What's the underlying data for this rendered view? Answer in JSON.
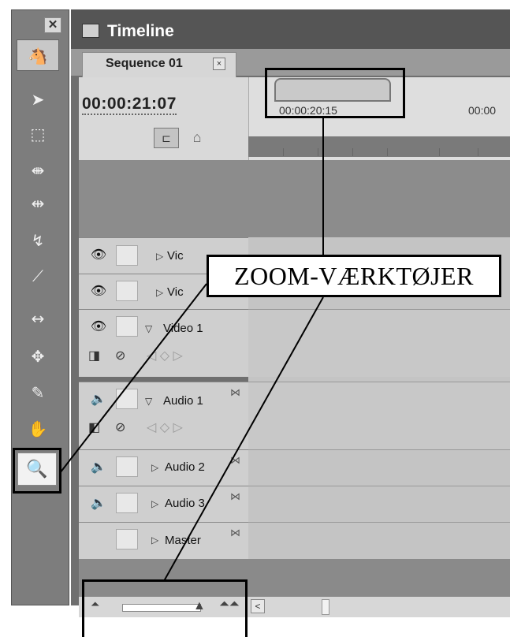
{
  "tools": {
    "close_label": "✕",
    "items": [
      "track-select-icon",
      "selection-arrow-icon",
      "ripple-edit-icon",
      "rolling-edit-icon",
      "rate-stretch-icon",
      "razor-icon",
      "slip-icon",
      "slide-icon",
      "pen-icon",
      "hand-icon",
      "zoom-icon"
    ]
  },
  "window": {
    "title": "Timeline"
  },
  "sequence": {
    "tab_label": "Sequence 01",
    "tab_close": "×",
    "timecode": "00:00:21:07",
    "ruler_tc_1": "00:00:20:15",
    "ruler_tc_2": "00:00"
  },
  "tracks": [
    {
      "label": "Vic"
    },
    {
      "label": "Vic"
    },
    {
      "label": "Video 1"
    },
    {
      "label": "Audio 1"
    },
    {
      "label": "Audio 2"
    },
    {
      "label": "Audio 3"
    },
    {
      "label": "Master"
    }
  ],
  "annotation": {
    "callout": "ZOOM-VÆRKTØJER"
  },
  "colors": {
    "panel_dark": "#6f6f6f",
    "panel_light": "#d9d9d9",
    "callout_border": "#000000"
  }
}
